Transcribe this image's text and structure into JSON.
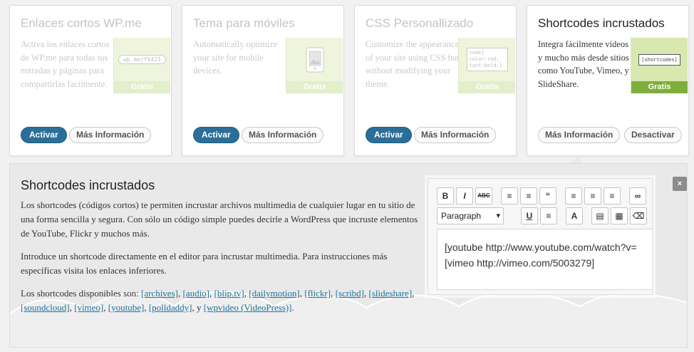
{
  "cards": [
    {
      "title": "Enlaces cortos WP.me",
      "description": "Activa los enlaces cortos de WP.me para todas tus entradas y páginas para compartirlas facilmente.",
      "badge": "Gratis",
      "thumb_text": "wp.me/fk421",
      "primary_label": "Activar",
      "secondary_label": "Más Información"
    },
    {
      "title": "Tema para móviles",
      "description": "Automatically optimize your site for mobile devices.",
      "badge": "Gratis",
      "primary_label": "Activar",
      "secondary_label": "Más Información"
    },
    {
      "title": "CSS Personallizado",
      "description": "Customize the appearance of your site using CSS but without modifying your theme.",
      "badge": "Gratis",
      "thumb_text": "code{ color:red; font:bold;}",
      "primary_label": "Activar",
      "secondary_label": "Más Información"
    },
    {
      "title": "Shortcodes incrustados",
      "description": "Integra fácilmente vídeos y mucho más desde sitios como YouTube, Vimeo, y SlideShare.",
      "badge": "Gratis",
      "thumb_text": "[shortcodes]",
      "secondary_label": "Más Información",
      "deactivate_label": "Desactivar"
    }
  ],
  "panel": {
    "title": "Shortcodes incrustados",
    "paragraph1": "Los shortcodes (códigos cortos) te permiten incrustar archivos multimedia de cualquier lugar en tu sitio de una forma sencilla y segura. Con sólo un código simple puedes decirle a WordPress que incruste elementos de YouTube, Flickr y muchos más.",
    "paragraph2": "Introduce un shortcode directamente en el editor para incrustar multimedia. Para instrucciones más específicas visita los enlaces inferiores.",
    "available_prefix": "Los shortcodes disponibles son:",
    "shortcodes": [
      "[archives]",
      "[audio]",
      "[blip.tv]",
      "[dailymotion]",
      "[flickr]",
      "[scribd]",
      "[slideshare]",
      "[soundcloud]",
      "[vimeo]",
      "[youtube]",
      "[polldaddy]",
      "[wpvideo (VideoPress)]"
    ],
    "conjunction": "y",
    "close_label": "×"
  },
  "editor": {
    "format_select": "Paragraph",
    "line1": "[youtube http://www.youtube.com/watch?v=",
    "line2": "[vimeo http://vimeo.com/5003279]",
    "toolbar_row1": [
      {
        "name": "bold",
        "glyph": "B"
      },
      {
        "name": "italic",
        "glyph": "I"
      },
      {
        "name": "strikethrough",
        "glyph": "ABC"
      },
      {
        "name": "bullet-list",
        "glyph": "≡"
      },
      {
        "name": "numbered-list",
        "glyph": "≡"
      },
      {
        "name": "blockquote",
        "glyph": "“"
      },
      {
        "name": "align-left",
        "glyph": "≡"
      },
      {
        "name": "align-center",
        "glyph": "≡"
      },
      {
        "name": "align-right",
        "glyph": "≡"
      },
      {
        "name": "link",
        "glyph": "∞"
      }
    ],
    "toolbar_row2": [
      {
        "name": "underline",
        "glyph": "U"
      },
      {
        "name": "justify",
        "glyph": "≡"
      },
      {
        "name": "text-color",
        "glyph": "A"
      },
      {
        "name": "paste-text",
        "glyph": "▤"
      },
      {
        "name": "paste-word",
        "glyph": "▦"
      },
      {
        "name": "clear-format",
        "glyph": "⌫"
      }
    ]
  },
  "colors": {
    "primary": "#2b6f99",
    "badge_active": "#7fae3c",
    "link": "#21759b"
  }
}
